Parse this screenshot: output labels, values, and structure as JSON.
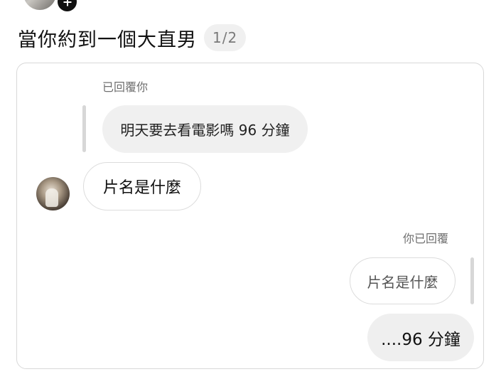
{
  "post": {
    "title": "當你約到一個大直男",
    "page_indicator": "1/2"
  },
  "chat": {
    "received_reply_label": "已回覆你",
    "quoted_message": "明天要去看電影嗎 96 分鐘",
    "received_message": "片名是什麼",
    "sent_reply_label": "你已回覆",
    "sent_quoted_message": "片名是什麼",
    "sent_message": "....96 分鐘"
  },
  "icons": {
    "add_badge": "plus-icon"
  },
  "colors": {
    "gray_bubble": "#f0f0f0",
    "outline": "#dcdcdc",
    "secondary_text": "#6f6f6f"
  }
}
